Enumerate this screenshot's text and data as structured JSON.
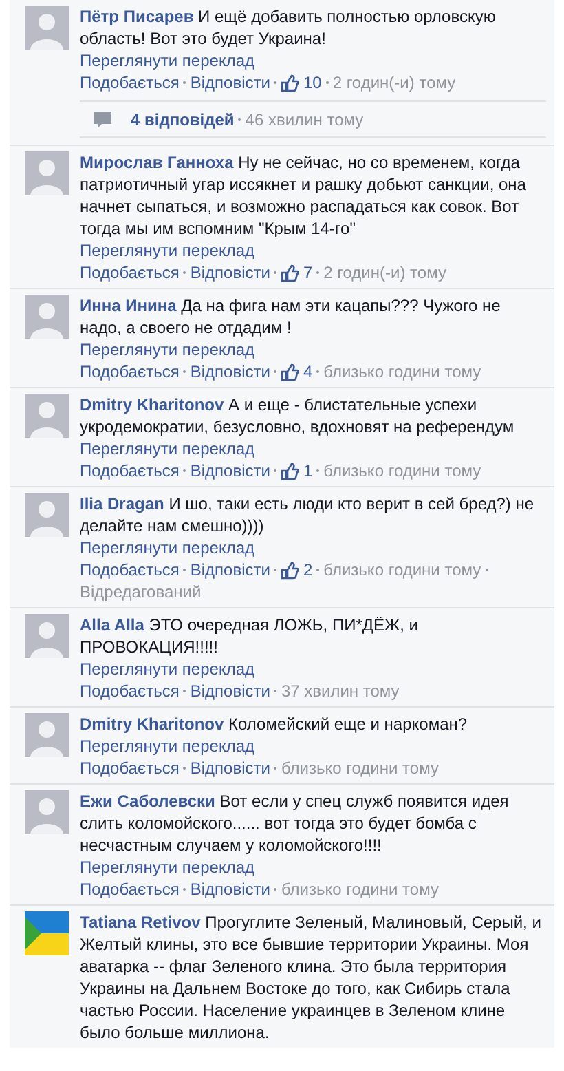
{
  "comments": [
    {
      "author": "Пётр Писарев",
      "kind": "person",
      "text": "И ещё добавить полностью орловскую область! Вот это будет Украина!",
      "translate": "Переглянути переклад",
      "like": "Подобається",
      "reply": "Відповісти",
      "likes": "10",
      "time": "2 годин(-и) тому",
      "replies": {
        "count": "4 відповідей",
        "time": "46 хвилин тому"
      }
    },
    {
      "author": "Мирослав Ганноха",
      "kind": "person",
      "text": "Ну не сейчас, но со временем, когда патриотичный угар иссякнет и рашку добьют санкции, она начнет сыпаться, и возможно распадаться как совок. Вот тогда мы им вспомним \"Крым 14-го\"",
      "translate": "Переглянути переклад",
      "like": "Подобається",
      "reply": "Відповісти",
      "likes": "7",
      "time": "2 годин(-и) тому"
    },
    {
      "author": "Инна Инина",
      "kind": "person",
      "text": "Да на фига нам эти кацапы??? Чужого не надо, а своего не отдадим !",
      "translate": "Переглянути переклад",
      "like": "Подобається",
      "reply": "Відповісти",
      "likes": "4",
      "time": "близько години тому"
    },
    {
      "author": "Dmitry Kharitonov",
      "kind": "person",
      "text": "А и еще - блистательные успехи укродемократии, безусловно, вдохновят на референдум",
      "translate": "Переглянути переклад",
      "like": "Подобається",
      "reply": "Відповісти",
      "likes": "1",
      "time": "близько години тому"
    },
    {
      "author": "Ilia Dragan",
      "kind": "person",
      "text": "И шо, таки есть люди кто верит в сей бред?) не делайте нам смешно))))",
      "translate": "Переглянути переклад",
      "like": "Подобається",
      "reply": "Відповісти",
      "likes": "2",
      "time": "близько години тому",
      "edited": "Відредагований"
    },
    {
      "author": "Alla Alla",
      "kind": "person",
      "text": "ЭТО очередная ЛОЖЬ, ПИ*ДЁЖ, и ПРОВОКАЦИЯ!!!!!",
      "translate": "Переглянути переклад",
      "like": "Подобається",
      "reply": "Відповісти",
      "time": "37 хвилин тому"
    },
    {
      "author": "Dmitry Kharitonov",
      "kind": "person",
      "text": "Коломейский еще и наркоман?",
      "translate": "Переглянути переклад",
      "like": "Подобається",
      "reply": "Відповісти",
      "time": "близько години тому"
    },
    {
      "author": "Ежи Саболевски",
      "kind": "person",
      "text": "Вот если у спец служб появится идея слить коломойского...... вот тогда это будет бомба с несчастным случаем у коломойского!!!!",
      "translate": "Переглянути переклад",
      "like": "Подобається",
      "reply": "Відповісти",
      "time": "близько години тому"
    },
    {
      "author": "Tatiana Retivov",
      "kind": "flag",
      "text": "Прогуглите Зеленый, Малиновый, Серый, и Желтый клины, это все бывшие территории Украины. Моя аватарка -- флаг Зеленого клина. Это была территория Украины на Дальнем Востоке до того, как Сибирь стала частью России. Население украинцев в Зеленом клине было больше миллиона."
    }
  ]
}
